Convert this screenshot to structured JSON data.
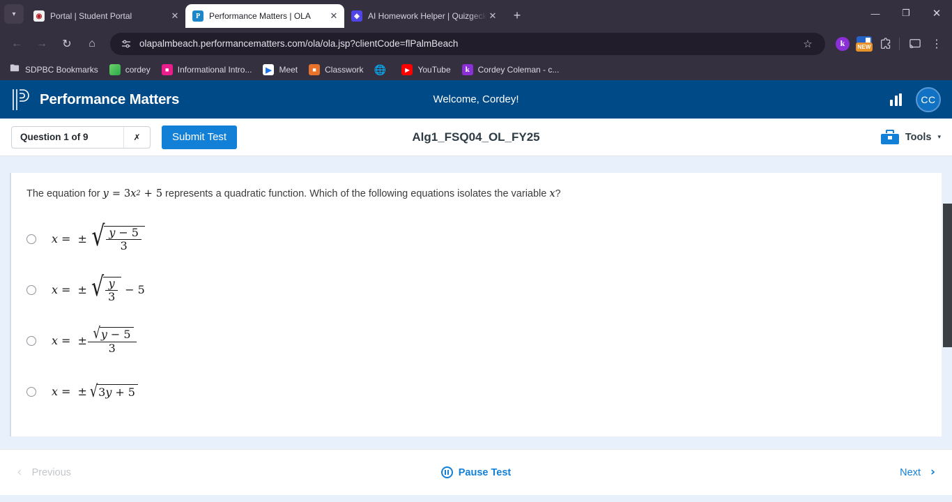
{
  "browser": {
    "tabs": [
      {
        "title": "Portal | Student Portal",
        "favicon": "portal-icon",
        "active": false
      },
      {
        "title": "Performance Matters | OLA",
        "favicon": "performance-matters-icon",
        "active": true
      },
      {
        "title": "AI Homework Helper | Quizgeck",
        "favicon": "quizgecko-icon",
        "active": false
      }
    ],
    "new_tab_label": "+",
    "tab_search_icon": "chevron-down-icon",
    "window_controls": {
      "minimize": "—",
      "maximize": "❐",
      "close": "✕"
    },
    "nav": {
      "back": "←",
      "forward": "→",
      "reload": "↻",
      "home": "⌂"
    },
    "omnibox": {
      "url": "olapalmbeach.performancematters.com/ola/ola.jsp?clientCode=flPalmBeach",
      "site_settings_icon": "tune-icon",
      "bookmark_icon": "star-icon"
    },
    "toolbar_extensions": [
      {
        "name": "kami-extension",
        "label": "k"
      },
      {
        "name": "new-extension",
        "label": "NEW"
      },
      {
        "name": "extensions-puzzle-icon",
        "label": ""
      },
      {
        "name": "cast-icon",
        "label": ""
      },
      {
        "name": "chrome-menu-icon",
        "label": "⋮"
      }
    ],
    "bookmarks": [
      {
        "label": "SDPBC Bookmarks",
        "icon": "folder-icon"
      },
      {
        "label": "cordey",
        "icon": "cordey-icon"
      },
      {
        "label": "Informational Intro...",
        "icon": "slides-icon"
      },
      {
        "label": "Meet",
        "icon": "meet-icon"
      },
      {
        "label": "Classwork",
        "icon": "classwork-icon"
      },
      {
        "label": "",
        "icon": "globe-icon"
      },
      {
        "label": "YouTube",
        "icon": "youtube-icon"
      },
      {
        "label": "Cordey Coleman - c...",
        "icon": "kami-icon"
      }
    ]
  },
  "app_header": {
    "brand": "Performance Matters",
    "welcome": "Welcome, Cordey!",
    "chart_icon": "bar-chart-icon",
    "avatar_initials": "CC",
    "bg_color": "#004b87"
  },
  "test_bar": {
    "question_selector": "Question 1 of 9",
    "selector_caret": "chevron-down-icon",
    "submit_label": "Submit Test",
    "test_title": "Alg1_FSQ04_OL_FY25",
    "tools_label": "Tools",
    "tools_icon": "toolbox-icon",
    "tools_caret": "▾",
    "accent_color": "#1380d8"
  },
  "question": {
    "prompt_before": "The equation for",
    "prompt_equation": "y = 3x² + 5",
    "prompt_middle": "represents a quadratic function. Which of the following equations isolates the variable",
    "prompt_variable": "x",
    "prompt_after": "?",
    "choices": [
      {
        "id": "A",
        "latex": "x = ±√((y − 5)/3)",
        "selected": false
      },
      {
        "id": "B",
        "latex": "x = ±√(y/3) − 5",
        "selected": false
      },
      {
        "id": "C",
        "latex": "x = ±(√(y − 5))/3",
        "selected": false
      },
      {
        "id": "D",
        "latex": "x = ±√(3y + 5)",
        "selected": false
      }
    ],
    "symbols": {
      "x": "x",
      "y": "y",
      "eq": "=",
      "pm": "±",
      "minus": "−",
      "plus": "+",
      "three": "3",
      "five": "5",
      "radical": "√",
      "sup2": "2"
    }
  },
  "footer": {
    "previous_label": "Previous",
    "previous_enabled": false,
    "pause_label": "Pause Test",
    "pause_icon": "pause-circle-icon",
    "next_label": "Next",
    "next_enabled": true,
    "prev_chevron": "‹",
    "next_chevron": "›"
  },
  "scrollbar": {
    "name": "content-scrollbar",
    "thumb_color": "#3c3f43"
  }
}
